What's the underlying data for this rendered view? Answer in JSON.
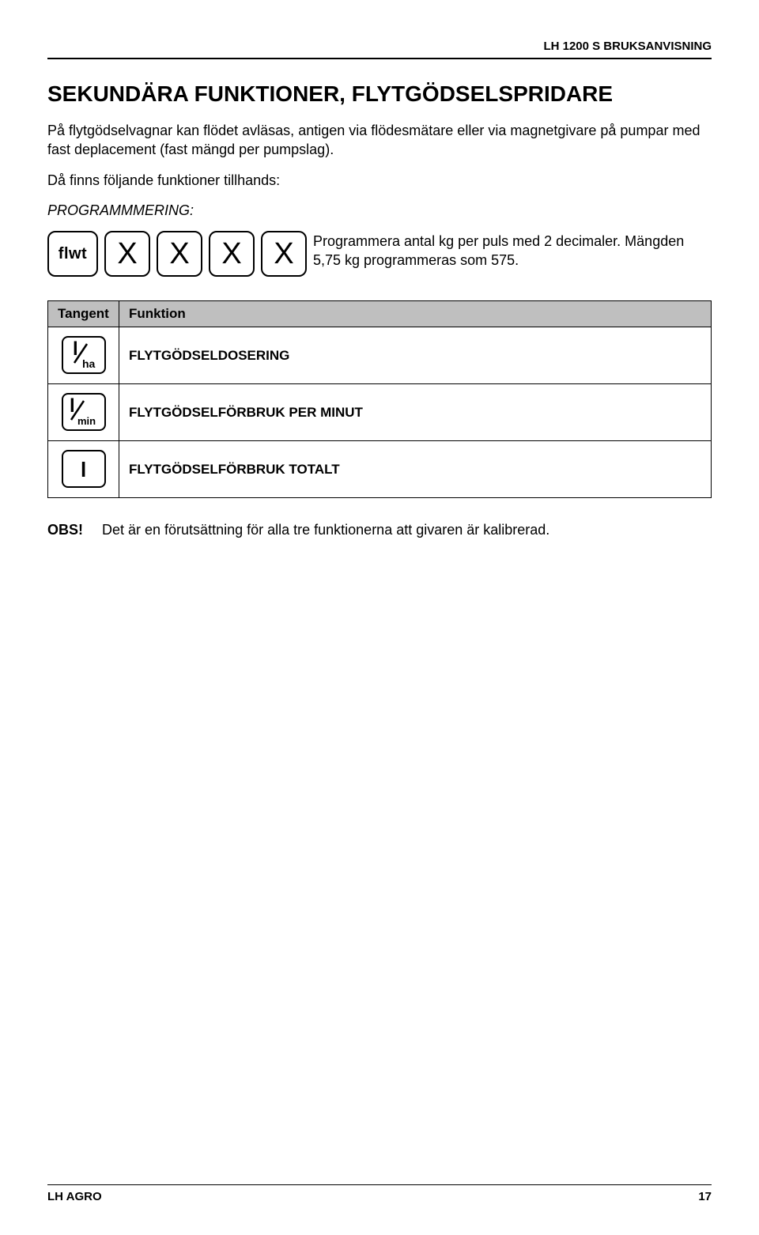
{
  "header": {
    "doc_title": "LH 1200 S BRUKSANVISNING"
  },
  "section": {
    "title": "SEKUNDÄRA FUNKTIONER, FLYTGÖDSELSPRIDARE",
    "intro_p1": "På flytgödselvagnar kan flödet avläsas, antigen via flödesmätare eller via magnetgivare på pumpar med fast deplacement (fast mängd per pumpslag).",
    "intro_p2": "Då finns följande funktioner tillhands:",
    "prog_label": "PROGRAMMMERING:",
    "key_flwt": "flwt",
    "key_x": "X",
    "prog_desc": "Programmera antal kg per puls med 2 decimaler. Mängden 5,75 kg programmeras som 575."
  },
  "table": {
    "col1": "Tangent",
    "col2": "Funktion",
    "rows": [
      {
        "icon": "l_per_ha",
        "desc": "FLYTGÖDSELDOSERING"
      },
      {
        "icon": "l_per_min",
        "desc": "FLYTGÖDSELFÖRBRUK PER MINUT"
      },
      {
        "icon": "l",
        "desc": "FLYTGÖDSELFÖRBRUK TOTALT"
      }
    ]
  },
  "obs": {
    "label": "OBS!",
    "text": "Det är en förutsättning för alla tre funktionerna att givaren är kalibrerad."
  },
  "footer": {
    "left": "LH AGRO",
    "right": "17"
  },
  "icons": {
    "l_per_ha_big": "l",
    "l_per_ha_sub": "ha",
    "l_per_min_big": "l",
    "l_per_min_sub": "min",
    "l_big": "l"
  }
}
